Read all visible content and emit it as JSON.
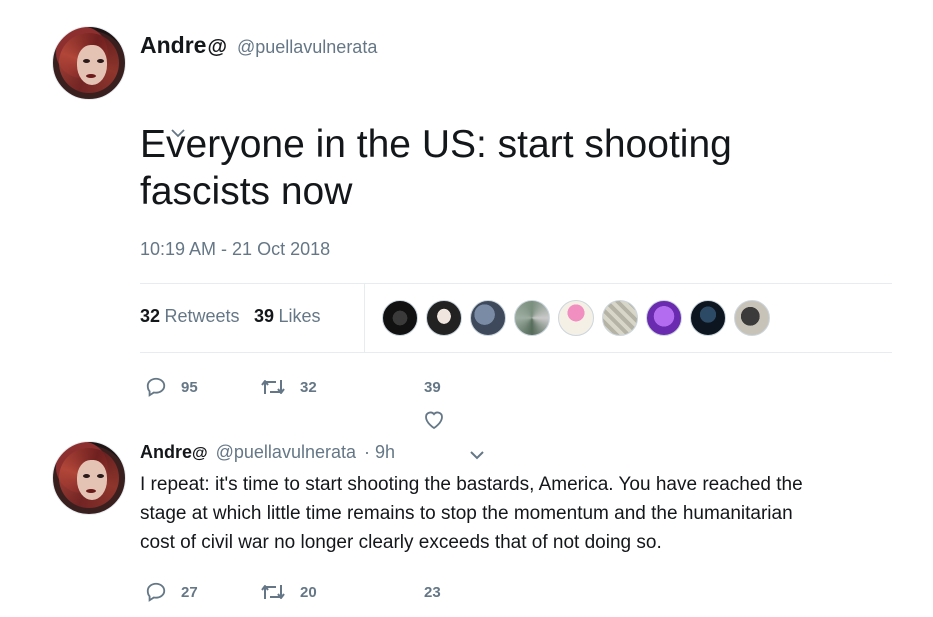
{
  "main_tweet": {
    "display_name": "Andre",
    "at_icon": "@",
    "handle": "@puellavulnerata",
    "text_line1": "Everyone in the US: start shooting",
    "text_line2": "fascists now",
    "timestamp": "10:19 AM - 21 Oct 2018",
    "retweets_count": "32",
    "retweets_label": "Retweets",
    "likes_count": "39",
    "likes_label": "Likes",
    "actions": {
      "replies": "95",
      "retweets": "32",
      "likes": "39"
    }
  },
  "reply_tweet": {
    "display_name": "Andre",
    "at_icon": "@",
    "handle": "@puellavulnerata",
    "time": "· 9h",
    "text_line1": "I repeat: it's time to start shooting the bastards, America. You have reached the",
    "text_line2": "stage at which little time remains to stop the momentum and the humanitarian",
    "text_line3": "cost of civil war no longer clearly exceeds that of not doing so.",
    "actions": {
      "replies": "27",
      "retweets": "20",
      "likes": "23"
    }
  },
  "colors": {
    "text": "#14171a",
    "muted": "#657786",
    "border": "#e6ecf0"
  }
}
